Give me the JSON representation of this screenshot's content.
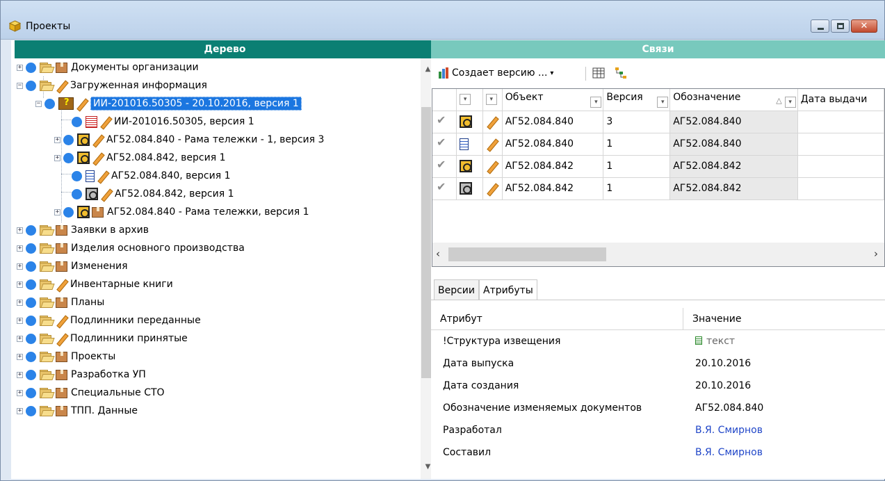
{
  "window": {
    "title": "Проекты"
  },
  "tree": {
    "header": "Дерево",
    "nodes": [
      {
        "label": "Документы организации"
      },
      {
        "label": "Загруженная информация"
      },
      {
        "label": "ИИ-201016.50305 - 20.10.2016, версия 1",
        "selected": true
      },
      {
        "label": "ИИ-201016.50305, версия 1"
      },
      {
        "label": "АГ52.084.840 - Рама тележки - 1, версия 3"
      },
      {
        "label": "АГ52.084.842, версия 1"
      },
      {
        "label": "АГ52.084.840, версия 1"
      },
      {
        "label": "АГ52.084.842, версия 1"
      },
      {
        "label": "АГ52.084.840 - Рама тележки, версия 1"
      },
      {
        "label": "Заявки в архив"
      },
      {
        "label": "Изделия основного производства"
      },
      {
        "label": "Изменения"
      },
      {
        "label": "Инвентарные книги"
      },
      {
        "label": "Планы"
      },
      {
        "label": "Подлинники переданные"
      },
      {
        "label": "Подлинники принятые"
      },
      {
        "label": "Проекты"
      },
      {
        "label": "Разработка УП"
      },
      {
        "label": "Специальные СТО"
      },
      {
        "label": "ТПП. Данные"
      }
    ]
  },
  "links": {
    "header": "Связи",
    "toolbar": {
      "relation_label": "Создает версию ...",
      "relation_arrow": "▾"
    },
    "grid": {
      "columns": [
        "Объект",
        "Версия",
        "Обозначение",
        "Дата выдачи"
      ],
      "sort_indicator": "△",
      "rows": [
        {
          "object": "АГ52.084.840",
          "version": "3",
          "designation": "АГ52.084.840"
        },
        {
          "object": "АГ52.084.840",
          "version": "1",
          "designation": "АГ52.084.840"
        },
        {
          "object": "АГ52.084.842",
          "version": "1",
          "designation": "АГ52.084.842"
        },
        {
          "object": "АГ52.084.842",
          "version": "1",
          "designation": "АГ52.084.842"
        }
      ]
    },
    "tabs": [
      "Версии",
      "Атрибуты"
    ],
    "active_tab": "Атрибуты",
    "attributes": {
      "col_name": "Атрибут",
      "col_value": "Значение",
      "rows": [
        {
          "name": "!Структура извещения",
          "value": "текст"
        },
        {
          "name": "Дата выпуска",
          "value": "20.10.2016"
        },
        {
          "name": "Дата создания",
          "value": "20.10.2016"
        },
        {
          "name": "Обозначение изменяемых документов",
          "value": "АГ52.084.840"
        },
        {
          "name": "Разработал",
          "value": "В.Я. Смирнов"
        },
        {
          "name": "Составил",
          "value": "В.Я. Смирнов"
        }
      ]
    }
  },
  "colors": {
    "tree_header": "#0b7f73",
    "links_header": "#78c9bd",
    "selection": "#1b76e0",
    "status_dot": "#2b83e8",
    "link_text": "#2046c8"
  }
}
